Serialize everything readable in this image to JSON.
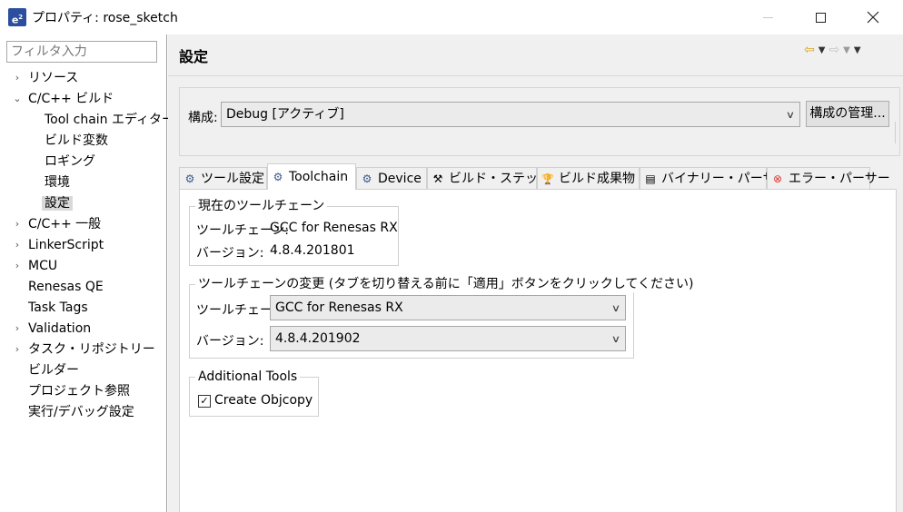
{
  "window": {
    "title": "プロパティ: rose_sketch",
    "icon_label": "e",
    "icon_sup": "2"
  },
  "filter": {
    "placeholder": "フィルタ入力"
  },
  "tree": [
    {
      "label": "リソース",
      "expand": "›"
    },
    {
      "label": "C/C++ ビルド",
      "expand": "⌄"
    },
    {
      "label": "Tool chain エディター",
      "expand": ""
    },
    {
      "label": "ビルド変数",
      "expand": ""
    },
    {
      "label": "ロギング",
      "expand": ""
    },
    {
      "label": "環境",
      "expand": ""
    },
    {
      "label": "設定",
      "expand": ""
    },
    {
      "label": "C/C++ 一般",
      "expand": "›"
    },
    {
      "label": "LinkerScript",
      "expand": "›"
    },
    {
      "label": "MCU",
      "expand": "›"
    },
    {
      "label": "Renesas QE",
      "expand": ""
    },
    {
      "label": "Task Tags",
      "expand": ""
    },
    {
      "label": "Validation",
      "expand": "›"
    },
    {
      "label": "タスク・リポジトリー",
      "expand": "›"
    },
    {
      "label": "ビルダー",
      "expand": ""
    },
    {
      "label": "プロジェクト参照",
      "expand": ""
    },
    {
      "label": "実行/デバッグ設定",
      "expand": ""
    }
  ],
  "page": {
    "title": "設定"
  },
  "config": {
    "label": "構成:",
    "value": "Debug  [アクティブ]",
    "manage_button": "構成の管理..."
  },
  "tabs": [
    {
      "label": "ツール設定",
      "icon": "gear-icon",
      "glyph": "⚙"
    },
    {
      "label": "Toolchain",
      "icon": "gear-icon",
      "glyph": "⚙"
    },
    {
      "label": "Device",
      "icon": "gear-icon",
      "glyph": "⚙"
    },
    {
      "label": "ビルド・ステップ",
      "icon": "wrench-icon",
      "glyph": "⚒"
    },
    {
      "label": "ビルド成果物",
      "icon": "trophy-icon",
      "glyph": "🏆"
    },
    {
      "label": "バイナリー・パーサー",
      "icon": "binary-icon",
      "glyph": "▤"
    },
    {
      "label": "エラー・パーサー",
      "icon": "error-icon",
      "glyph": "⊗"
    }
  ],
  "current_toolchain": {
    "title": "現在のツールチェーン",
    "toolchain_label": "ツールチェーン:",
    "toolchain_value": "GCC for Renesas RX",
    "version_label": "バージョン:",
    "version_value": "4.8.4.201801"
  },
  "change_toolchain": {
    "title": "ツールチェーンの変更  (タブを切り替える前に「適用」ボタンをクリックしてください)",
    "toolchain_label": "ツールチェーン:",
    "toolchain_value": "GCC for Renesas RX",
    "version_label": "バージョン:",
    "version_value": "4.8.4.201902"
  },
  "additional_tools": {
    "title": "Additional Tools",
    "create_objcopy_label": "Create Objcopy",
    "create_objcopy_checked": true
  },
  "colors": {
    "accent_back_arrow": "#d8a31a",
    "selection": "#d9d9d9",
    "panel_bg": "#f0f0f0"
  }
}
